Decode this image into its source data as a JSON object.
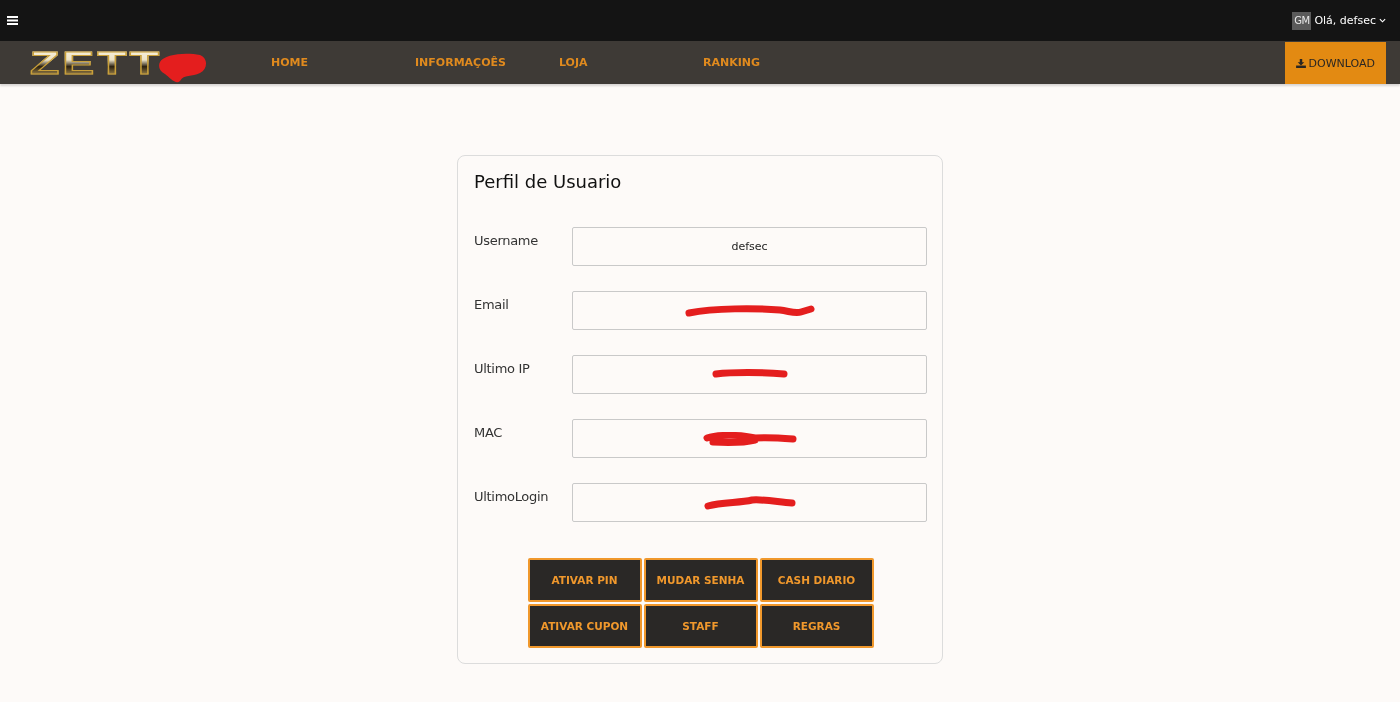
{
  "top_bar": {
    "user": {
      "avatar_text": "GM",
      "greeting": "Olá, defsec"
    }
  },
  "nav": {
    "logo": {
      "text": "ZETT",
      "redacted": true
    },
    "items": [
      {
        "label": "HOME",
        "selected": false
      },
      {
        "label": "INFORMAÇOÊS",
        "selected": false
      },
      {
        "label": "LOJA",
        "selected": false
      },
      {
        "label": "RANKING",
        "selected": false
      }
    ],
    "download_button": "DOWNLOAD"
  },
  "profile": {
    "title": "Perfil de Usuario",
    "fields": [
      {
        "label": "Username",
        "value": "defsec",
        "redacted": false
      },
      {
        "label": "Email",
        "redacted": true
      },
      {
        "label": "Ultimo IP",
        "redacted": true
      },
      {
        "label": "MAC",
        "redacted": true
      },
      {
        "label": "UltimoLogin",
        "redacted": true
      }
    ],
    "buttons": [
      "ATIVAR PIN",
      "MUDAR SENHA",
      "CASH DIARIO",
      "ATIVAR CUPON",
      "STAFF",
      "REGRAS"
    ]
  }
}
